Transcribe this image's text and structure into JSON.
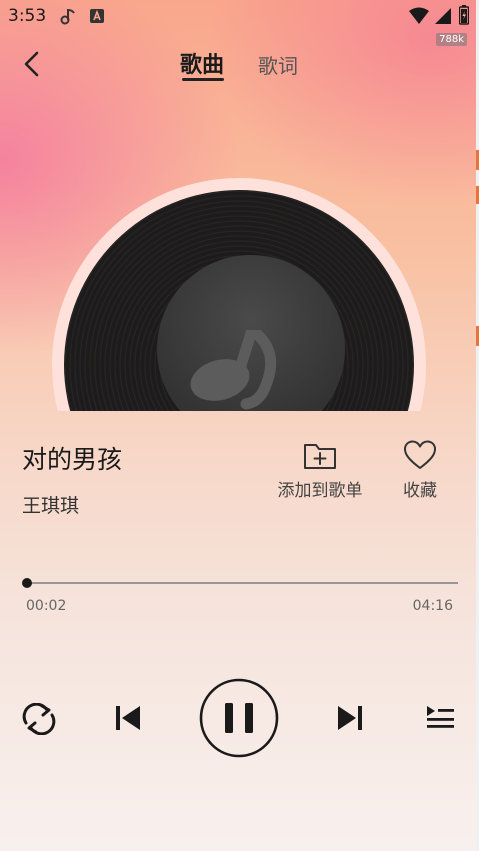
{
  "status_bar": {
    "time": "3:53",
    "speed": "788k",
    "icons": [
      "music-app-icon",
      "a-app-icon",
      "wifi-icon",
      "signal-icon",
      "battery-icon"
    ]
  },
  "header": {
    "back_icon": "chevron-left-icon",
    "tabs": [
      {
        "label": "歌曲",
        "active": true
      },
      {
        "label": "歌词",
        "active": false
      }
    ]
  },
  "disc": {
    "center_icon": "music-note-icon"
  },
  "song": {
    "title": "对的男孩",
    "artist": "王琪琪"
  },
  "actions": {
    "add_to_playlist": {
      "label": "添加到歌单",
      "icon": "folder-plus-icon"
    },
    "favorite": {
      "label": "收藏",
      "icon": "heart-icon"
    }
  },
  "progress": {
    "current": "00:02",
    "total": "04:16",
    "fraction": 0.008
  },
  "controls": {
    "repeat_icon": "repeat-icon",
    "previous_icon": "skip-previous-icon",
    "play_state": "playing",
    "pause_icon": "pause-icon",
    "next_icon": "skip-next-icon",
    "playlist_icon": "playlist-icon"
  },
  "colors": {
    "accent_dark": "#1a1a1a",
    "gradient_top": "#f9a78c",
    "gradient_pink": "#f478a0",
    "gradient_bottom": "#f8f0ee",
    "disc_ring": "#fde1da"
  }
}
